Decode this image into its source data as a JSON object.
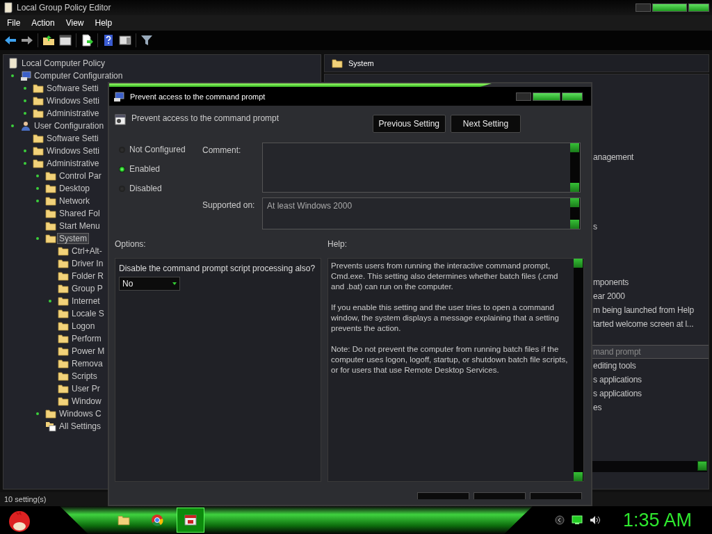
{
  "window": {
    "title": "Local Group Policy Editor"
  },
  "menu": [
    "File",
    "Action",
    "View",
    "Help"
  ],
  "tree": [
    {
      "label": "Local Computer Policy",
      "kind": "policy",
      "expandable": false,
      "selected": false,
      "children": [
        {
          "label": "Computer Configuration",
          "kind": "computer",
          "expandable": true,
          "selected": false,
          "children": [
            {
              "label": "Software Setti",
              "kind": "folder",
              "expandable": true,
              "selected": false
            },
            {
              "label": "Windows Setti",
              "kind": "folder",
              "expandable": true,
              "selected": false
            },
            {
              "label": "Administrative",
              "kind": "folder",
              "expandable": true,
              "selected": false
            }
          ]
        },
        {
          "label": "User Configuration",
          "kind": "user",
          "expandable": true,
          "selected": false,
          "children": [
            {
              "label": "Software Setti",
              "kind": "folder",
              "expandable": false,
              "selected": false
            },
            {
              "label": "Windows Setti",
              "kind": "folder",
              "expandable": true,
              "selected": false
            },
            {
              "label": "Administrative",
              "kind": "folder",
              "expandable": true,
              "selected": false,
              "children": [
                {
                  "label": "Control Par",
                  "kind": "folder",
                  "expandable": true,
                  "selected": false
                },
                {
                  "label": "Desktop",
                  "kind": "folder",
                  "expandable": true,
                  "selected": false
                },
                {
                  "label": "Network",
                  "kind": "folder",
                  "expandable": true,
                  "selected": false
                },
                {
                  "label": "Shared Fol",
                  "kind": "folder",
                  "expandable": false,
                  "selected": false
                },
                {
                  "label": "Start Menu",
                  "kind": "folder",
                  "expandable": false,
                  "selected": false
                },
                {
                  "label": "System",
                  "kind": "folder",
                  "expandable": true,
                  "selected": true,
                  "children": [
                    {
                      "label": "Ctrl+Alt-",
                      "kind": "folder",
                      "expandable": false,
                      "selected": false
                    },
                    {
                      "label": "Driver In",
                      "kind": "folder",
                      "expandable": false,
                      "selected": false
                    },
                    {
                      "label": "Folder R",
                      "kind": "folder",
                      "expandable": false,
                      "selected": false
                    },
                    {
                      "label": "Group P",
                      "kind": "folder",
                      "expandable": false,
                      "selected": false
                    },
                    {
                      "label": "Internet",
                      "kind": "folder",
                      "expandable": true,
                      "selected": false
                    },
                    {
                      "label": "Locale S",
                      "kind": "folder",
                      "expandable": false,
                      "selected": false
                    },
                    {
                      "label": "Logon",
                      "kind": "folder",
                      "expandable": false,
                      "selected": false
                    },
                    {
                      "label": "Perform",
                      "kind": "folder",
                      "expandable": false,
                      "selected": false
                    },
                    {
                      "label": "Power M",
                      "kind": "folder",
                      "expandable": false,
                      "selected": false
                    },
                    {
                      "label": "Remova",
                      "kind": "folder",
                      "expandable": false,
                      "selected": false
                    },
                    {
                      "label": "Scripts",
                      "kind": "folder",
                      "expandable": false,
                      "selected": false
                    },
                    {
                      "label": "User Pr",
                      "kind": "folder",
                      "expandable": false,
                      "selected": false
                    },
                    {
                      "label": "Window",
                      "kind": "folder",
                      "expandable": false,
                      "selected": false
                    }
                  ]
                },
                {
                  "label": "Windows C",
                  "kind": "folder",
                  "expandable": true,
                  "selected": false
                },
                {
                  "label": "All Settings",
                  "kind": "settings",
                  "expandable": false,
                  "selected": false
                }
              ]
            }
          ]
        }
      ]
    }
  ],
  "details": {
    "header": "System",
    "rows": [
      {
        "text": "anagement",
        "selected": false
      },
      {
        "text": "s",
        "selected": false
      },
      {
        "text": "mponents",
        "selected": false
      },
      {
        "text": "ear 2000",
        "selected": false
      },
      {
        "text": "m being launched from Help",
        "selected": false
      },
      {
        "text": "tarted welcome screen at l...",
        "selected": false
      },
      {
        "text": "mand prompt",
        "selected": true
      },
      {
        "text": "editing tools",
        "selected": false
      },
      {
        "text": "s applications",
        "selected": false
      },
      {
        "text": "s applications",
        "selected": false
      },
      {
        "text": "es",
        "selected": false
      }
    ]
  },
  "status_bar": "10 setting(s)",
  "dialog": {
    "title": "Prevent access to the command prompt",
    "setting_name": "Prevent access to the command prompt",
    "buttons": [
      "Previous Setting",
      "Next Setting"
    ],
    "states": [
      {
        "label": "Not Configured",
        "selected": false
      },
      {
        "label": "Enabled",
        "selected": true
      },
      {
        "label": "Disabled",
        "selected": false
      }
    ],
    "comment": {
      "label": "Comment:"
    },
    "supported_on": {
      "label": "Supported on:",
      "value": "At least Windows 2000"
    },
    "options": {
      "label": "Options:",
      "prompt": "Disable the command prompt script processing also?",
      "dropdown": "No"
    },
    "help": {
      "label": "Help:",
      "paragraphs": [
        "Prevents users from running the interactive command prompt, Cmd.exe. This setting also determines whether batch files (.cmd and .bat) can run on the computer.",
        "If you enable this setting and the user tries to open a command window, the system displays a message explaining that a setting prevents the action.",
        "Note: Do not prevent the computer from running batch files if the computer uses logon, logoff, startup, or shutdown batch file scripts, or for users that use Remote Desktop Services."
      ]
    }
  },
  "taskbar": {
    "apps": [
      {
        "kind": "folder",
        "selected": false
      },
      {
        "kind": "browser",
        "selected": false
      },
      {
        "kind": "policy",
        "selected": true
      }
    ],
    "clock": "1:35 AM"
  }
}
